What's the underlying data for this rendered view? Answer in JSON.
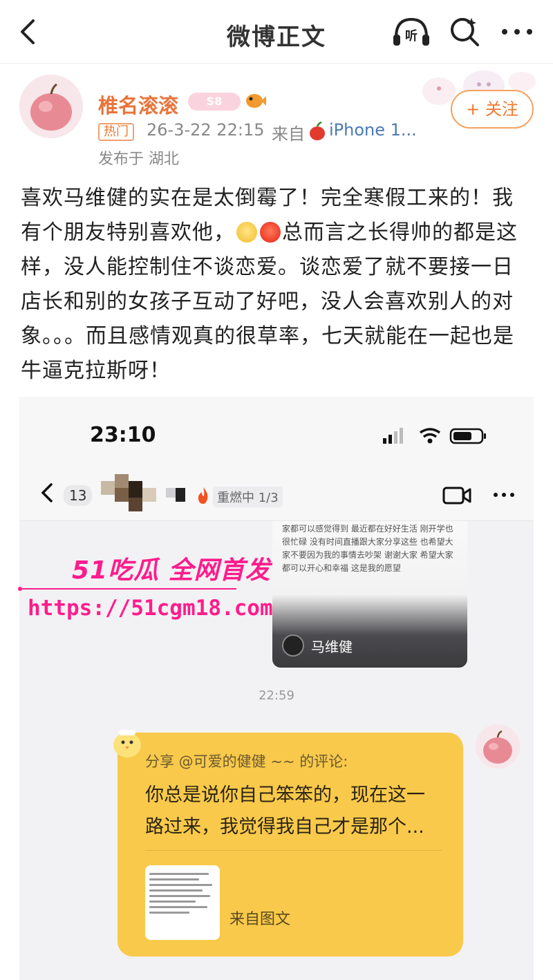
{
  "header": {
    "title": "微博正文",
    "listen_label": "听"
  },
  "post": {
    "author": "椎名滚滚",
    "level_badge": "S8",
    "hot_tag": "热门",
    "time": "26-3-22 22:15",
    "from_label": "来自",
    "device": "iPhone 1...",
    "location": "发布于 湖北",
    "follow_label": "+ 关注",
    "text_1": "喜欢马维健的实在是太倒霉了！完全寒假工来的！我有个朋友特别喜欢他，",
    "text_2": "总而言之长得帅的都是这样，没人能控制住不谈恋爱。谈恋爱了就不要接一日店长和别的女孩子互动了好吧，没人会喜欢别人的对象。。。而且感情观真的很草率，七天就能在一起也是牛逼克拉斯呀！"
  },
  "screenshot": {
    "time": "23:10",
    "unread_count": "13",
    "fire_status": "重燃中 1/3",
    "card_text": "家都可以感觉得到 最近都在好好生活 刚开学也很忙碌 没有时间直播跟大家分享这些 也希望大家不要因为我的事情去吵架 谢谢大家 希望大家都可以开心和幸福 这是我的愿望",
    "card_name": "马维健",
    "timestamp": "22:59",
    "share_from": "分享 @可爱的健健 ~~ 的评论:",
    "share_text": "你总是说你自己笨笨的，现在这一路过来，我觉得我自己才是那个...",
    "share_source": "来自图文"
  },
  "watermark": {
    "title": "51吃瓜 全网首发",
    "url": "https://51cgm18.com"
  },
  "colors": {
    "username": "#e8743b",
    "link_blue": "#4a7ab5",
    "bubble_yellow": "#f9c94b",
    "watermark_pink": "#ff1c8c"
  },
  "icons": [
    "back-icon",
    "listen-icon",
    "search-icon",
    "more-icon",
    "fish-icon",
    "apple-icon",
    "signal-icon",
    "wifi-icon",
    "battery-icon",
    "flame-icon",
    "video-icon",
    "chick-icon"
  ]
}
